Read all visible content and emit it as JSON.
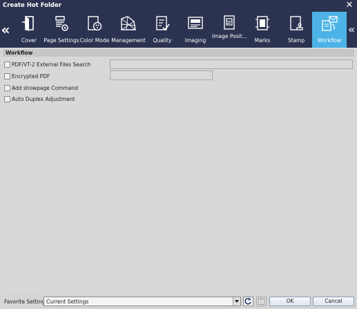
{
  "window": {
    "title": "Create Hot Folder",
    "close_icon": "close-icon"
  },
  "toolbar": {
    "tabs": [
      {
        "label": "Cover",
        "icon": "cover-icon"
      },
      {
        "label": "Page Settings",
        "icon": "page-settings-icon"
      },
      {
        "label": "Color Mode",
        "icon": "color-mode-icon"
      },
      {
        "label": "Management",
        "icon": "management-icon"
      },
      {
        "label": "Quality",
        "icon": "quality-icon"
      },
      {
        "label": "Imaging",
        "icon": "imaging-icon"
      },
      {
        "label": "Image Posit...",
        "icon": "image-position-icon"
      },
      {
        "label": "Marks",
        "icon": "marks-icon"
      },
      {
        "label": "Stamp",
        "icon": "stamp-icon"
      },
      {
        "label": "Workflow",
        "icon": "workflow-icon"
      }
    ],
    "active_tab": "Workflow",
    "prev_icon": "chevron-left-icon",
    "next_icon": "chevron-right-icon",
    "prev_glyph": "«",
    "next_glyph": "«"
  },
  "workflow": {
    "section_title": "Workflow",
    "options": [
      {
        "label": "PDF/VT-2 External Files Search",
        "checked": false
      },
      {
        "label": "Encrypted PDF",
        "checked": false
      },
      {
        "label": "Add showpage Command",
        "checked": false
      },
      {
        "label": "Auto Duplex Adjustment",
        "checked": false
      }
    ],
    "external_files_value": "",
    "password_value": ""
  },
  "footer": {
    "favorite_label": "Favorite Setting",
    "favorite_value": "Current Settings",
    "refresh_icon": "refresh-icon",
    "save_icon": "save-icon",
    "ok_label": "OK",
    "cancel_label": "Cancel"
  },
  "colors": {
    "titlebar": "#2b3350",
    "active_tab": "#4db3e6",
    "background": "#d6d6d6"
  }
}
